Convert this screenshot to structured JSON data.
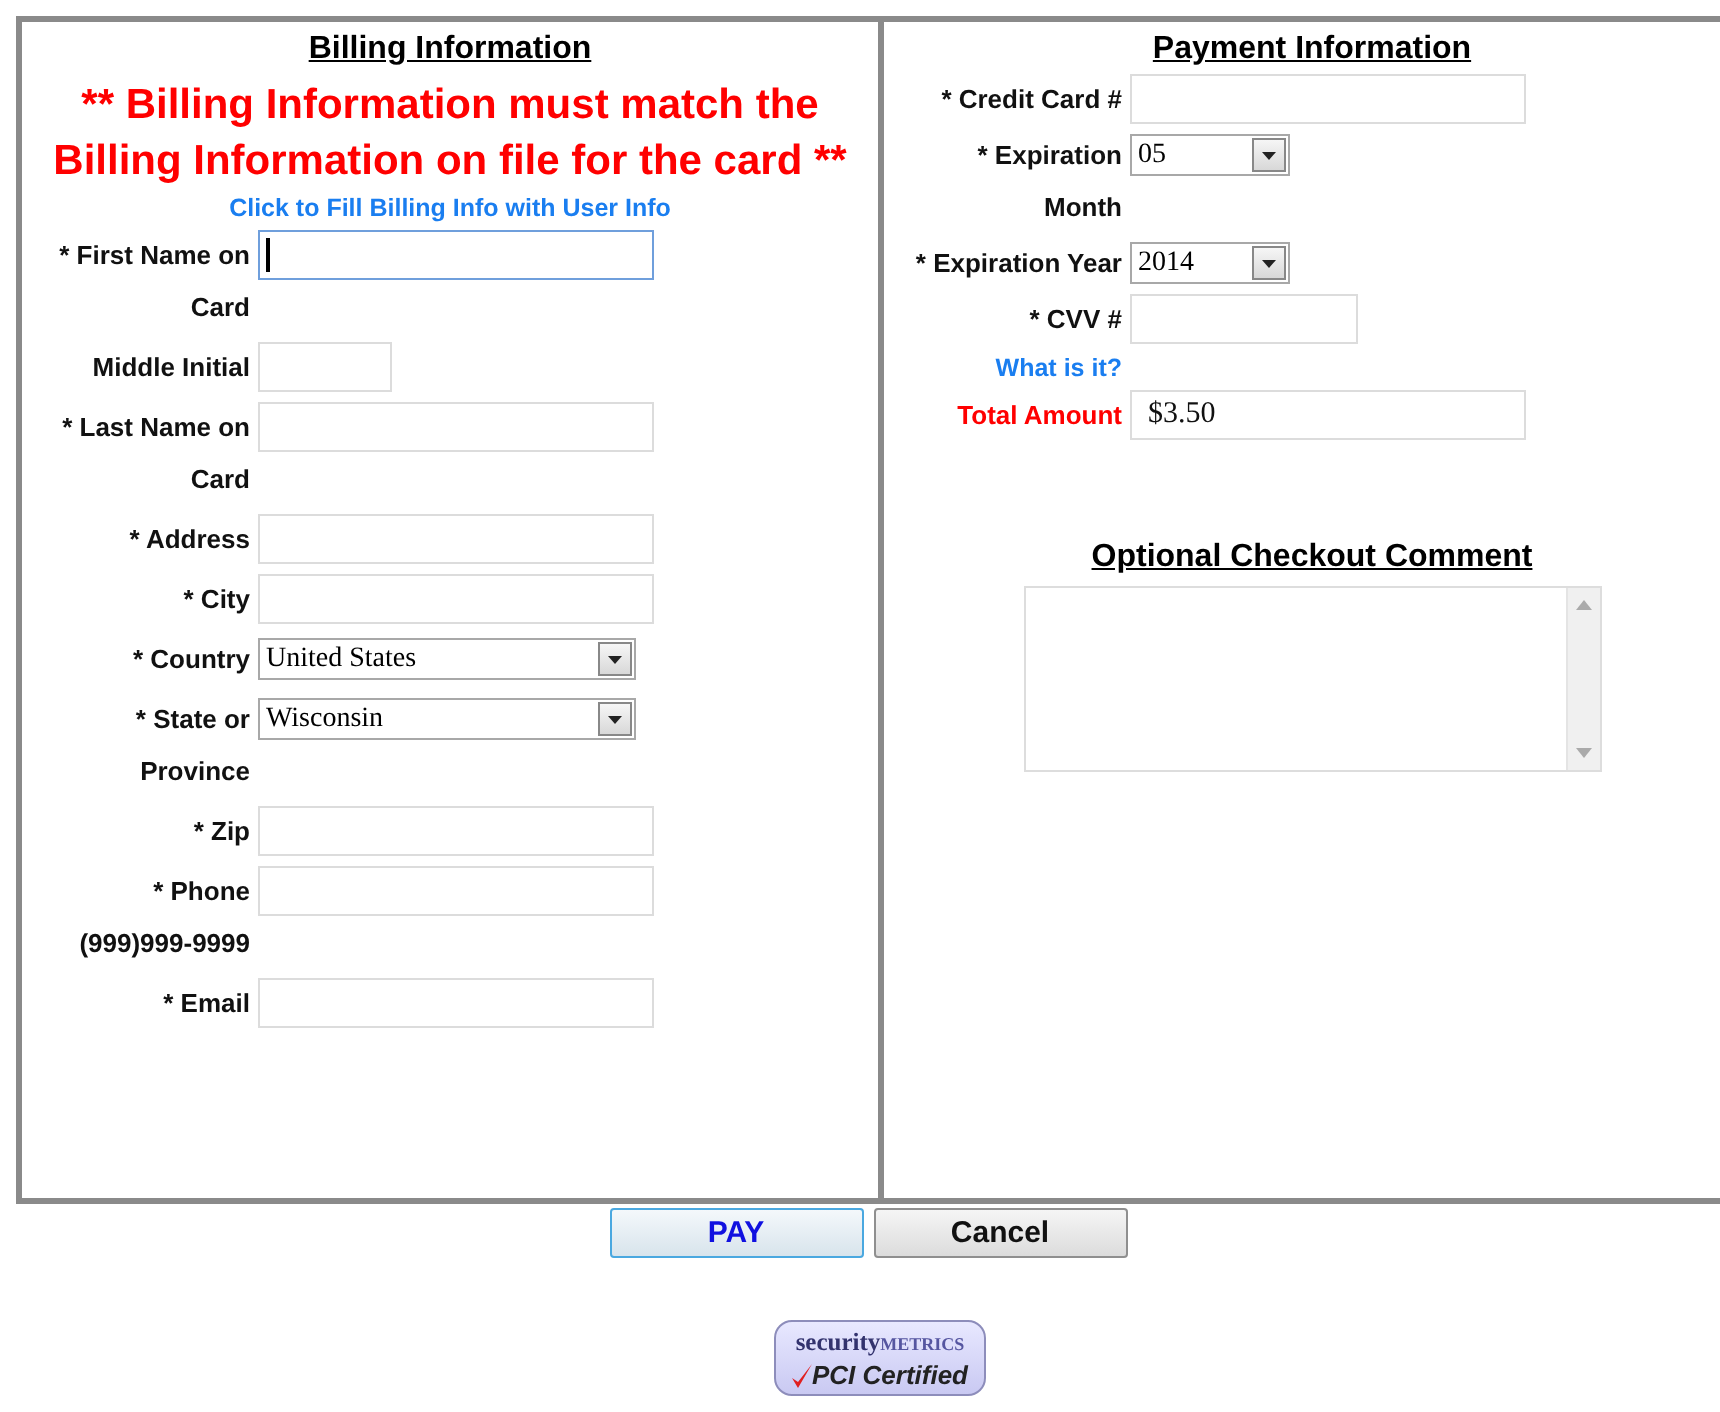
{
  "billing": {
    "title": "Billing Information",
    "warning": "** Billing Information must match the Billing Information on file for the card **",
    "fill_link": "Click to Fill Billing Info with User Info",
    "fields": [
      {
        "label": "* First Name on Card",
        "kind": "text",
        "focused": true
      },
      {
        "label": "Middle Initial",
        "kind": "short",
        "focused": false
      },
      {
        "label": "* Last Name on Card",
        "kind": "text",
        "focused": false
      },
      {
        "label": "* Address",
        "kind": "text",
        "focused": false
      },
      {
        "label": "* City",
        "kind": "text",
        "focused": false
      },
      {
        "label": "* Country",
        "kind": "select",
        "value": "United States",
        "focused": false
      },
      {
        "label": "* State or Province",
        "kind": "select",
        "value": "Wisconsin",
        "focused": false
      },
      {
        "label": "* Zip",
        "kind": "text",
        "focused": false
      },
      {
        "label": "* Phone (999)999-9999",
        "kind": "text",
        "focused": false
      },
      {
        "label": "* Email",
        "kind": "text",
        "focused": false
      }
    ]
  },
  "payment": {
    "title": "Payment Information",
    "fields": [
      {
        "label": "* Credit Card #",
        "kind": "text"
      },
      {
        "label": "* Expiration Month",
        "kind": "select",
        "value": "05"
      },
      {
        "label": "* Expiration Year",
        "kind": "select",
        "value": "2014"
      },
      {
        "label": "* CVV #",
        "kind": "short"
      },
      {
        "label": "What is it?",
        "kind": "link"
      },
      {
        "label": "Total Amount",
        "kind": "total",
        "value": "$3.50"
      }
    ]
  },
  "comment": {
    "title": "Optional Checkout Comment"
  },
  "buttons": [
    {
      "label": "PAY",
      "kind": "primary"
    },
    {
      "label": "Cancel",
      "kind": "secondary"
    }
  ],
  "badge": {
    "brand": "security",
    "brand_suffix": "METRICS",
    "label": "PCI Certified"
  }
}
